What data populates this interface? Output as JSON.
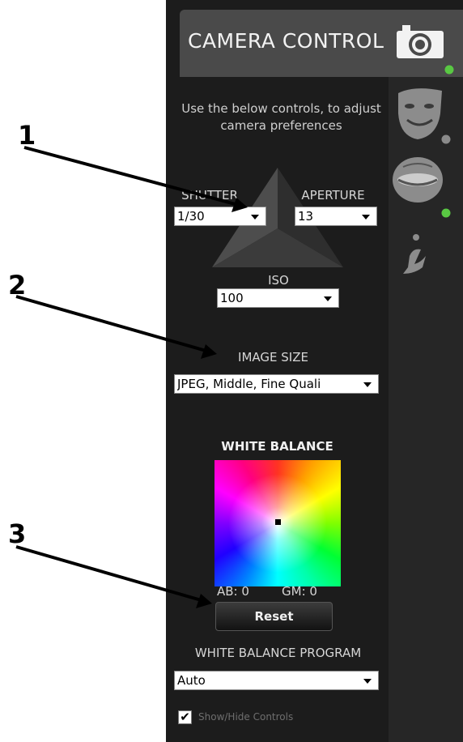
{
  "header": {
    "title": "CAMERA CONTROL"
  },
  "intro_text": "Use the below controls, to adjust camera preferences",
  "exposure": {
    "shutter": {
      "label": "SHUTTER",
      "value": "1/30"
    },
    "aperture": {
      "label": "APERTURE",
      "value": "13"
    },
    "iso": {
      "label": "ISO",
      "value": "100"
    }
  },
  "image_size": {
    "label": "IMAGE SIZE",
    "value": "JPEG, Middle, Fine Quali"
  },
  "white_balance": {
    "title": "WHITE BALANCE",
    "ab": "AB: 0",
    "gm": "GM: 0",
    "reset_label": "Reset",
    "program_label": "WHITE BALANCE PROGRAM",
    "program_value": "Auto"
  },
  "show_hide": {
    "label": "Show/Hide Controls",
    "checked": true,
    "mark": "✔"
  },
  "callouts": [
    "1",
    "2",
    "3"
  ],
  "rail_icons": [
    "camera-icon",
    "drama-mask-icon",
    "face-icon",
    "info-icon"
  ],
  "colors": {
    "panel_bg": "#1c1c1c",
    "header_bg": "#4a4a4a",
    "status_green": "#59c843",
    "status_gray": "#8a8a8a"
  }
}
